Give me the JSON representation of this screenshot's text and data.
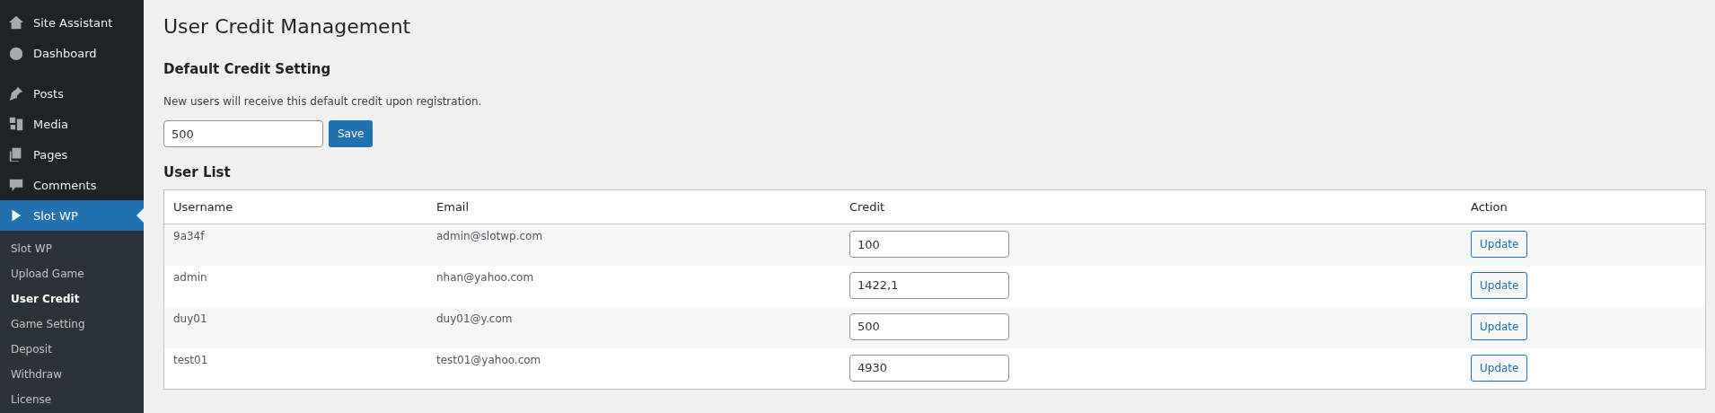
{
  "sidebar": {
    "items": [
      {
        "label": "Site Assistant",
        "selected": false
      },
      {
        "label": "Dashboard",
        "selected": false
      },
      {
        "label": "Posts",
        "selected": false
      },
      {
        "label": "Media",
        "selected": false
      },
      {
        "label": "Pages",
        "selected": false
      },
      {
        "label": "Comments",
        "selected": false
      },
      {
        "label": "Slot WP",
        "selected": true
      }
    ],
    "submenu": [
      {
        "label": "Slot WP",
        "selected": false
      },
      {
        "label": "Upload Game",
        "selected": false
      },
      {
        "label": "User Credit",
        "selected": true
      },
      {
        "label": "Game Setting",
        "selected": false
      },
      {
        "label": "Deposit",
        "selected": false
      },
      {
        "label": "Withdraw",
        "selected": false
      },
      {
        "label": "License",
        "selected": false
      }
    ]
  },
  "page_title": "User Credit Management",
  "default_credit": {
    "heading": "Default Credit Setting",
    "description": "New users will receive this default credit upon registration.",
    "value": "500",
    "button": "Save"
  },
  "user_list": {
    "heading": "User List",
    "columns": [
      "Username",
      "Email",
      "Credit",
      "Action"
    ],
    "rows": [
      {
        "username": "9a34f",
        "email": "admin@slotwp.com",
        "credit": "100",
        "action": "Update"
      },
      {
        "username": "admin",
        "email": "nhan@yahoo.com",
        "credit": "1422,1",
        "action": "Update"
      },
      {
        "username": "duy01",
        "email": "duy01@y.com",
        "credit": "500",
        "action": "Update"
      },
      {
        "username": "test01",
        "email": "test01@yahoo.com",
        "credit": "4930",
        "action": "Update"
      }
    ]
  }
}
